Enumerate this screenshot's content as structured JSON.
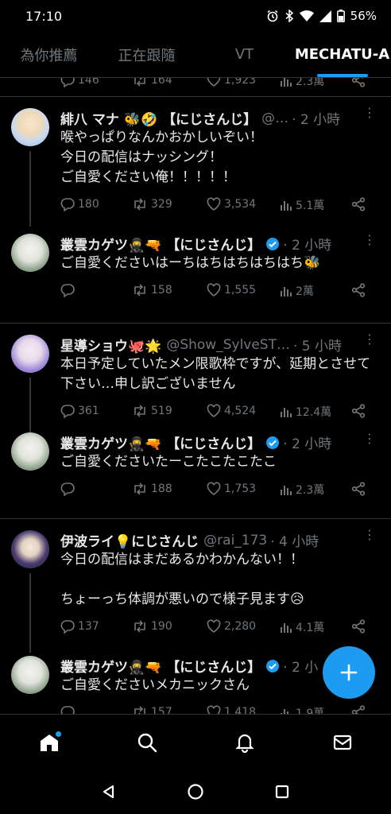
{
  "status_bar": {
    "time": "17:10",
    "battery": "56%"
  },
  "tabs": [
    {
      "label": "為你推薦",
      "active": false
    },
    {
      "label": "正在跟隨",
      "active": false
    },
    {
      "label": "VT",
      "active": false
    },
    {
      "label": "MECHATU-A",
      "active": true
    }
  ],
  "partial": {
    "replies": "146",
    "retweets": "164",
    "likes": "1,923",
    "views": "2.3萬"
  },
  "threads": [
    {
      "root": {
        "name": "緋八 マナ 🐝🤣 【にじさんじ】",
        "handle": "@…",
        "time": "· 2 小時",
        "text": "喉やっぱりなんかおかしいぞい！\n今日の配信はナッシング！\nご自愛ください俺！！！！！",
        "replies": "180",
        "retweets": "329",
        "likes": "3,534",
        "views": "5.1萬"
      },
      "reply": {
        "name": "叢雲カゲツ🥷🔫 【にじさんじ】",
        "time": "· 2 小時",
        "text": "ご自愛くださいはーちはちはちはちはち🐝",
        "replies": "",
        "retweets": "158",
        "likes": "1,555",
        "views": "2萬"
      }
    },
    {
      "root": {
        "name": "星導ショウ🐙🌟",
        "handle": "@Show_SylveST…",
        "time": "· 5 小時",
        "text": "本日予定していたメン限歌枠ですが、延期とさせて下さい…申し訳ございません",
        "replies": "361",
        "retweets": "519",
        "likes": "4,524",
        "views": "12.4萬"
      },
      "reply": {
        "name": "叢雲カゲツ🥷🔫 【にじさんじ】",
        "time": "· 2 小時",
        "text": "ご自愛くださいたーこたこたこたこ",
        "replies": "",
        "retweets": "188",
        "likes": "1,753",
        "views": "2.3萬"
      }
    },
    {
      "root": {
        "name": "伊波ライ💡にじさんじ",
        "handle": "@rai_173",
        "time": "· 4 小時",
        "text": "今日の配信はまだあるかわかんない！！\n\nちょーっち体調が悪いので様子見ます😥",
        "replies": "137",
        "retweets": "190",
        "likes": "2,280",
        "views": "4.1萬"
      },
      "reply": {
        "name": "叢雲カゲツ🥷🔫 【にじさんじ】",
        "time": "· 2 小",
        "text": "ご自愛くださいメカニックさん",
        "replies": "",
        "retweets": "157",
        "likes": "1,418",
        "views": "1.9萬"
      }
    }
  ],
  "colors": {
    "accent": "#1d9bf0",
    "background": "#000000",
    "muted": "#71767b",
    "divider": "#2f3336"
  },
  "icons": [
    "alarm-icon",
    "bluetooth-icon",
    "wifi-icon",
    "signal-icon",
    "battery-icon",
    "reply-icon",
    "retweet-icon",
    "like-icon",
    "views-icon",
    "share-icon",
    "home-icon",
    "search-icon",
    "bell-icon",
    "mail-icon",
    "plus-icon",
    "back-icon",
    "home-circle-icon",
    "recents-icon"
  ]
}
